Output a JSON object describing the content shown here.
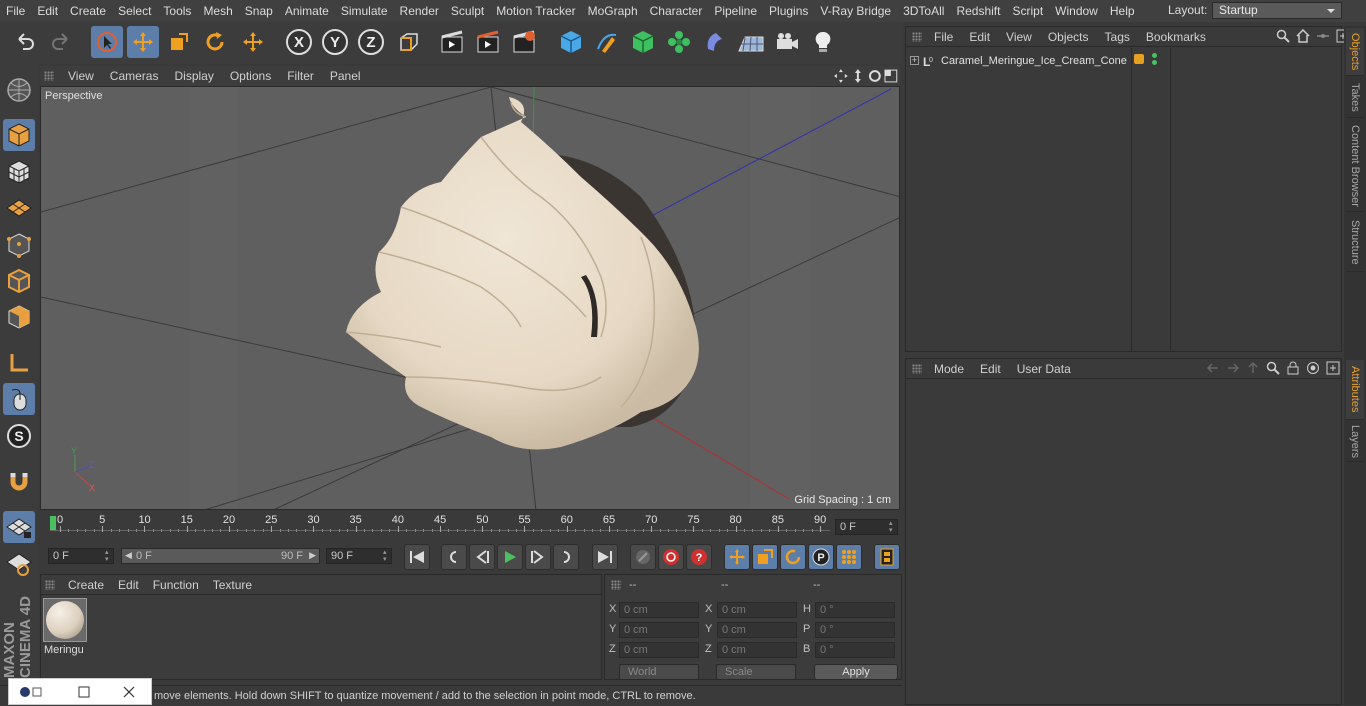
{
  "menubar": [
    "File",
    "Edit",
    "Create",
    "Select",
    "Tools",
    "Mesh",
    "Snap",
    "Animate",
    "Simulate",
    "Render",
    "Sculpt",
    "Motion Tracker",
    "MoGraph",
    "Character",
    "Pipeline",
    "Plugins",
    "V-Ray Bridge",
    "3DToAll",
    "Redshift",
    "Script",
    "Window",
    "Help"
  ],
  "layout": {
    "label": "Layout:",
    "value": "Startup"
  },
  "viewport": {
    "menu": [
      "View",
      "Cameras",
      "Display",
      "Options",
      "Filter",
      "Panel"
    ],
    "label": "Perspective",
    "grid_spacing": "Grid Spacing : 1 cm"
  },
  "timeline": {
    "ticks": [
      "0",
      "5",
      "10",
      "15",
      "20",
      "25",
      "30",
      "35",
      "40",
      "45",
      "50",
      "55",
      "60",
      "65",
      "70",
      "75",
      "80",
      "85",
      "90"
    ],
    "current_frame": "0 F"
  },
  "transport": {
    "start_field": "0 F",
    "range_start": "0 F",
    "range_end": "90 F",
    "end_field": "90 F"
  },
  "material_panel": {
    "menu": [
      "Create",
      "Edit",
      "Function",
      "Texture"
    ],
    "material_name": "Meringu"
  },
  "coord_panel": {
    "headers": [
      "--",
      "--",
      "--"
    ],
    "rows": [
      {
        "a": "X",
        "av": "0 cm",
        "b": "X",
        "bv": "0 cm",
        "c": "H",
        "cv": "0 °"
      },
      {
        "a": "Y",
        "av": "0 cm",
        "b": "Y",
        "bv": "0 cm",
        "c": "P",
        "cv": "0 °"
      },
      {
        "a": "Z",
        "av": "0 cm",
        "b": "Z",
        "bv": "0 cm",
        "c": "B",
        "cv": "0 °"
      }
    ],
    "world": "World",
    "scale": "Scale",
    "apply": "Apply"
  },
  "status": "move elements. Hold down SHIFT to quantize movement / add to the selection in point mode, CTRL to remove.",
  "objects_panel": {
    "menu": [
      "File",
      "Edit",
      "View",
      "Objects",
      "Tags",
      "Bookmarks"
    ],
    "object_name": "Caramel_Meringue_Ice_Cream_Cone"
  },
  "attributes_panel": {
    "menu": [
      "Mode",
      "Edit",
      "User Data"
    ]
  },
  "side_tabs": {
    "top": [
      "Objects",
      "Takes",
      "Content Browser",
      "Structure"
    ],
    "bottom": [
      "Attributes",
      "Layers"
    ]
  },
  "brand": "MAXON CINEMA 4D",
  "colors": {
    "accent": "#5d7ea8",
    "active_tab": "#e6a030",
    "viewport_bg": "#5f5f5f",
    "meringue": "#eadfcf"
  }
}
